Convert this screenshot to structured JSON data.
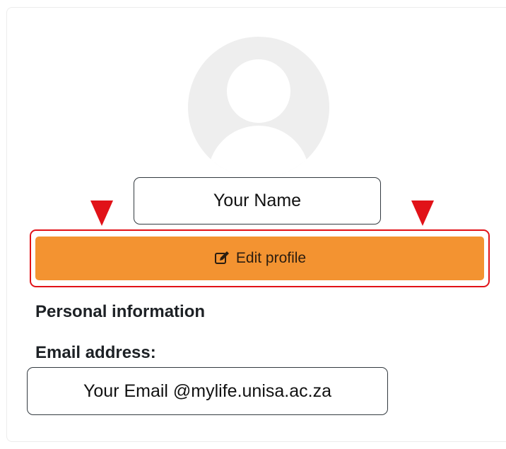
{
  "profile": {
    "name": "Your Name",
    "edit_button_label": "Edit profile",
    "edit_icon": "edit-icon"
  },
  "personal_info": {
    "section_title": "Personal information",
    "email_label": "Email address:",
    "email_value": "Your Email @mylife.unisa.ac.za"
  },
  "colors": {
    "accent": "#f39331",
    "annotation": "#e11218"
  }
}
